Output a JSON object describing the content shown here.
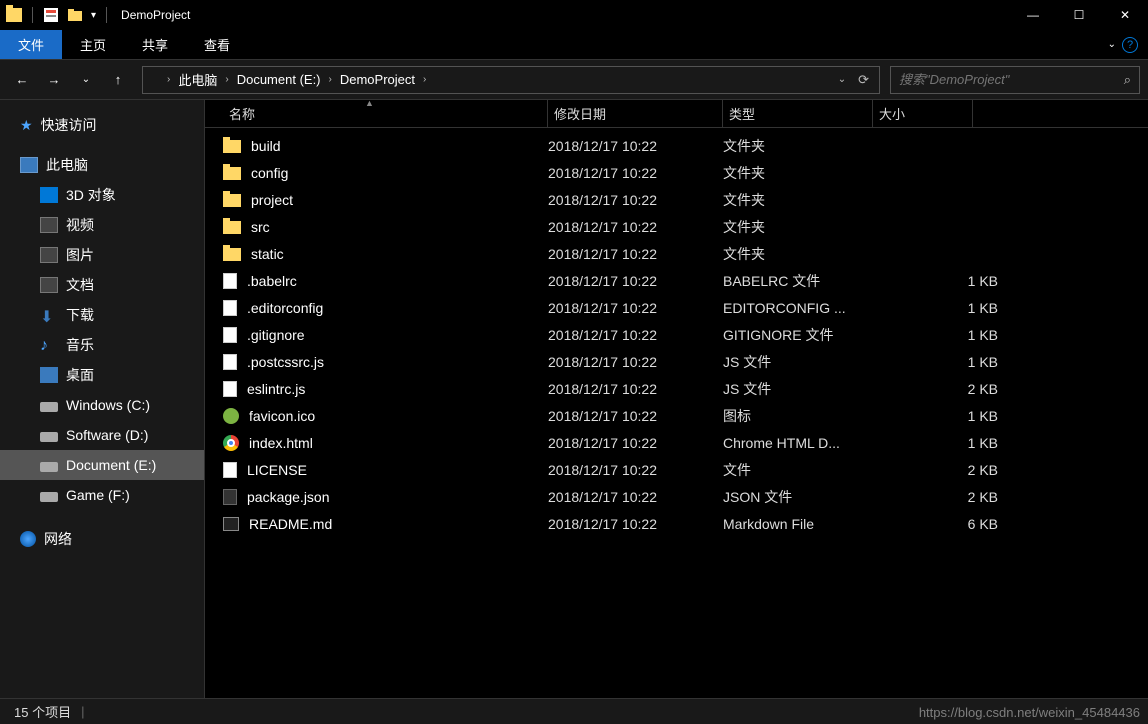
{
  "window": {
    "title": "DemoProject",
    "minimize": "—",
    "maximize": "☐",
    "close": "✕"
  },
  "ribbon": {
    "tabs": [
      "文件",
      "主页",
      "共享",
      "查看"
    ],
    "help": "?"
  },
  "nav": {
    "breadcrumb": [
      "此电脑",
      "Document (E:)",
      "DemoProject"
    ],
    "search_placeholder": "搜索\"DemoProject\""
  },
  "sidebar": {
    "quick_access": "快速访问",
    "this_pc": "此电脑",
    "items": [
      {
        "label": "3D 对象",
        "ico": "ico-3d"
      },
      {
        "label": "视频",
        "ico": "ico-video"
      },
      {
        "label": "图片",
        "ico": "ico-pic"
      },
      {
        "label": "文档",
        "ico": "ico-doc"
      },
      {
        "label": "下载",
        "ico": "ico-dl",
        "glyph": "⬇"
      },
      {
        "label": "音乐",
        "ico": "ico-music",
        "glyph": "♪"
      },
      {
        "label": "桌面",
        "ico": "ico-desk"
      },
      {
        "label": "Windows (C:)",
        "ico": "ico-drive"
      },
      {
        "label": "Software (D:)",
        "ico": "ico-drive"
      },
      {
        "label": "Document (E:)",
        "ico": "ico-drive",
        "selected": true
      },
      {
        "label": "Game (F:)",
        "ico": "ico-drive"
      }
    ],
    "network": "网络"
  },
  "columns": {
    "name": "名称",
    "date": "修改日期",
    "type": "类型",
    "size": "大小"
  },
  "files": [
    {
      "name": "build",
      "date": "2018/12/17 10:22",
      "type": "文件夹",
      "size": "",
      "ico": "fi-folder"
    },
    {
      "name": "config",
      "date": "2018/12/17 10:22",
      "type": "文件夹",
      "size": "",
      "ico": "fi-folder"
    },
    {
      "name": "project",
      "date": "2018/12/17 10:22",
      "type": "文件夹",
      "size": "",
      "ico": "fi-folder"
    },
    {
      "name": "src",
      "date": "2018/12/17 10:22",
      "type": "文件夹",
      "size": "",
      "ico": "fi-folder"
    },
    {
      "name": "static",
      "date": "2018/12/17 10:22",
      "type": "文件夹",
      "size": "",
      "ico": "fi-folder"
    },
    {
      "name": ".babelrc",
      "date": "2018/12/17 10:22",
      "type": "BABELRC 文件",
      "size": "1 KB",
      "ico": "fi-file"
    },
    {
      "name": ".editorconfig",
      "date": "2018/12/17 10:22",
      "type": "EDITORCONFIG ...",
      "size": "1 KB",
      "ico": "fi-file"
    },
    {
      "name": ".gitignore",
      "date": "2018/12/17 10:22",
      "type": "GITIGNORE 文件",
      "size": "1 KB",
      "ico": "fi-file"
    },
    {
      "name": ".postcssrc.js",
      "date": "2018/12/17 10:22",
      "type": "JS 文件",
      "size": "1 KB",
      "ico": "fi-js"
    },
    {
      "name": "eslintrc.js",
      "date": "2018/12/17 10:22",
      "type": "JS 文件",
      "size": "2 KB",
      "ico": "fi-js"
    },
    {
      "name": "favicon.ico",
      "date": "2018/12/17 10:22",
      "type": "图标",
      "size": "1 KB",
      "ico": "fi-favicon"
    },
    {
      "name": "index.html",
      "date": "2018/12/17 10:22",
      "type": "Chrome HTML D...",
      "size": "1 KB",
      "ico": "fi-chrome"
    },
    {
      "name": "LICENSE",
      "date": "2018/12/17 10:22",
      "type": "文件",
      "size": "2 KB",
      "ico": "fi-file"
    },
    {
      "name": "package.json",
      "date": "2018/12/17 10:22",
      "type": "JSON 文件",
      "size": "2 KB",
      "ico": "fi-json"
    },
    {
      "name": "README.md",
      "date": "2018/12/17 10:22",
      "type": "Markdown File",
      "size": "6 KB",
      "ico": "fi-md"
    }
  ],
  "status": {
    "count": "15 个项目"
  },
  "watermark": "https://blog.csdn.net/weixin_45484436"
}
